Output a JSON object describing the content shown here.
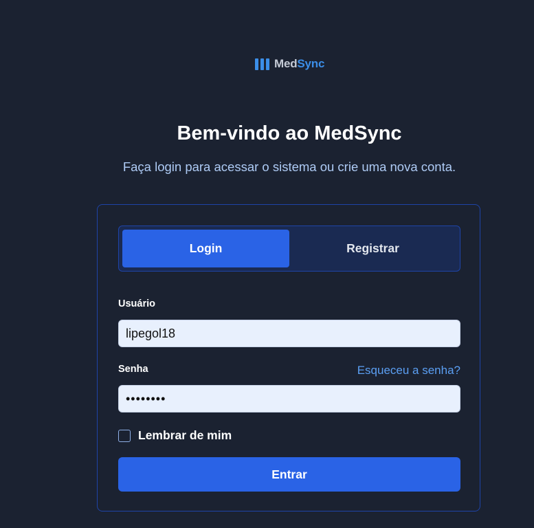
{
  "brand": {
    "name_part1": "Med",
    "name_part2": "Sync",
    "icon": "bars-icon",
    "colors": {
      "background": "#1b2231",
      "accent": "#2a63e6",
      "logo_accent": "#3b8ee8",
      "link": "#5b9ff3",
      "subtitle": "#aecbf5",
      "border": "#1e44a8"
    }
  },
  "header": {
    "title": "Bem-vindo ao MedSync",
    "subtitle": "Faça login para acessar o sistema ou crie uma nova conta."
  },
  "tabs": [
    {
      "label": "Login",
      "active": true
    },
    {
      "label": "Registrar",
      "active": false
    }
  ],
  "form": {
    "username": {
      "label": "Usuário",
      "value": "lipegol18"
    },
    "password": {
      "label": "Senha",
      "value": "••••••••",
      "forgot_label": "Esqueceu a senha?"
    },
    "remember": {
      "label": "Lembrar de mim",
      "checked": false
    },
    "submit_label": "Entrar"
  }
}
